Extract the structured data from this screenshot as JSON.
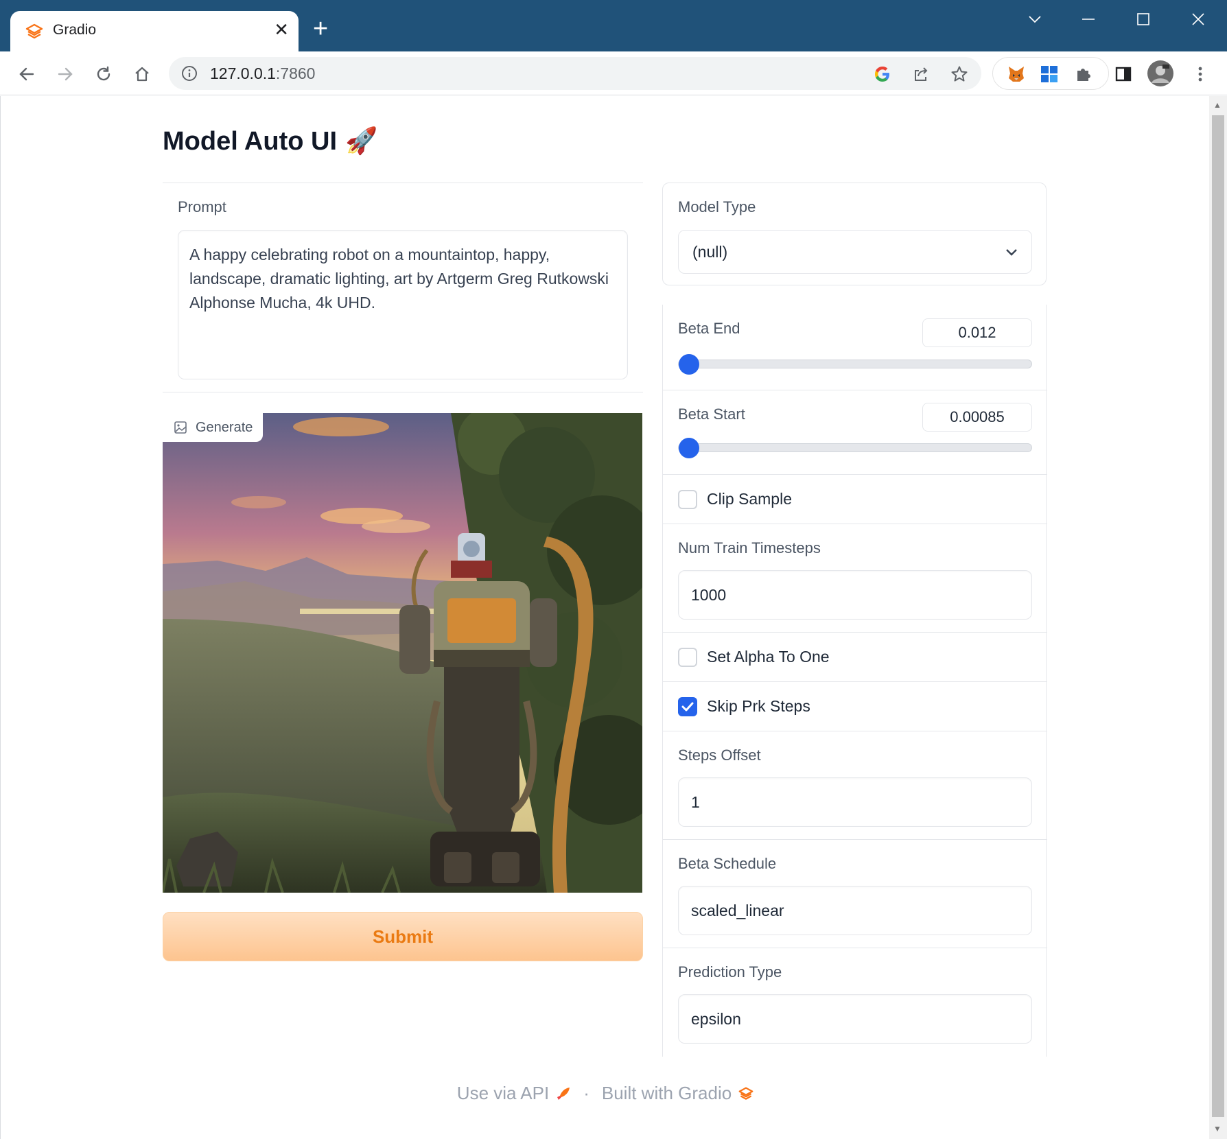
{
  "browser": {
    "tab_title": "Gradio",
    "url_host": "127.0.0.1",
    "url_port": ":7860"
  },
  "app": {
    "title": "Model Auto UI",
    "title_emoji": "🚀"
  },
  "prompt": {
    "label": "Prompt",
    "value": "A happy celebrating robot on a mountaintop, happy, landscape, dramatic lighting, art by Artgerm Greg Rutkowski Alphonse Mucha, 4k UHD."
  },
  "output_image": {
    "label": "Generate"
  },
  "submit_label": "Submit",
  "settings": {
    "model_type": {
      "label": "Model Type",
      "value": "(null)"
    },
    "beta_end": {
      "label": "Beta End",
      "value": "0.012",
      "fraction": 0.0
    },
    "beta_start": {
      "label": "Beta Start",
      "value": "0.00085",
      "fraction": 0.0
    },
    "clip_sample": {
      "label": "Clip Sample",
      "checked": false
    },
    "num_train_timesteps": {
      "label": "Num Train Timesteps",
      "value": "1000"
    },
    "set_alpha_to_one": {
      "label": "Set Alpha To One",
      "checked": false
    },
    "skip_prk_steps": {
      "label": "Skip Prk Steps",
      "checked": true
    },
    "steps_offset": {
      "label": "Steps Offset",
      "value": "1"
    },
    "beta_schedule": {
      "label": "Beta Schedule",
      "value": "scaled_linear"
    },
    "prediction_type": {
      "label": "Prediction Type",
      "value": "epsilon"
    }
  },
  "footer": {
    "api_link": "Use via API",
    "separator": "·",
    "built_with": "Built with Gradio"
  },
  "colors": {
    "titlebar": "#205279",
    "accent": "#2563eb",
    "submit_text": "#ea7a12",
    "gradio_orange": "#f97316"
  }
}
